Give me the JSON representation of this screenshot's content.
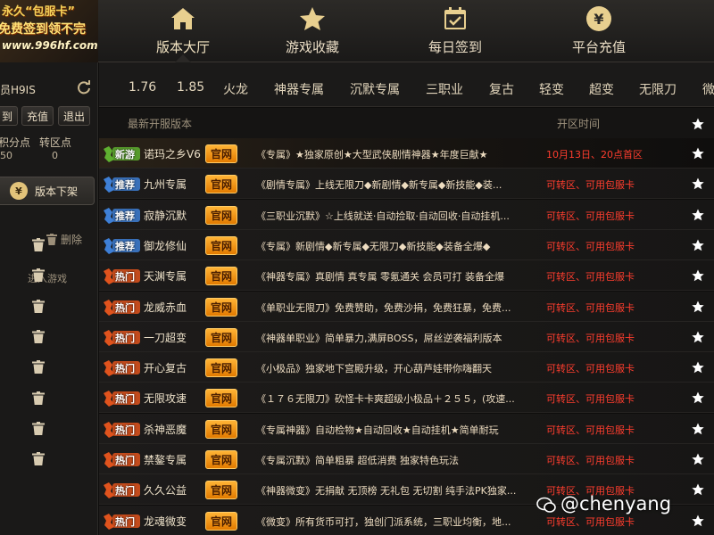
{
  "logo": {
    "line1": "永久“包服卡”",
    "line2": "免费签到领不完",
    "line3": "www.996hf.com"
  },
  "nav": [
    {
      "label": "版本大厅",
      "icon": "home-icon"
    },
    {
      "label": "游戏收藏",
      "icon": "star-icon"
    },
    {
      "label": "每日签到",
      "icon": "calendar-check-icon"
    },
    {
      "label": "平台充值",
      "icon": "yen-coin-icon"
    }
  ],
  "sidebar": {
    "username": "员H9IS",
    "btn_a": "到",
    "btn_b": "充值",
    "btn_c": "退出",
    "points_label": "积分点",
    "transfer_label": "转区点",
    "points_value": "50",
    "transfer_value": "0",
    "down_label": "版本下架",
    "delete_label": "删除",
    "enter_game": "进入游戏"
  },
  "filters": [
    "1.76",
    "1.85",
    "火龙",
    "神器专属",
    "沉默专属",
    "三职业",
    "复古",
    "轻变",
    "超变",
    "无限刀",
    "微"
  ],
  "table": {
    "col_latest": "最新开服版本",
    "col_time": "开区时间",
    "official_label": "官网",
    "rows": [
      {
        "tag": "新游",
        "tag_type": "new",
        "name": "诺玛之乡V6",
        "desc": "《专属》★独家原创★大型武侠剧情神器★年度巨献★",
        "time": "10月13日、20点首区"
      },
      {
        "tag": "推荐",
        "tag_type": "rec",
        "name": "九州专属",
        "desc": "《剧情专属》上线无限刀◆新剧情◆新专属◆新技能◆装...",
        "time": "可转区、可用包服卡"
      },
      {
        "tag": "推荐",
        "tag_type": "rec",
        "name": "寂静沉默",
        "desc": "《三职业沉默》☆上线就送·自动捡取·自动回收·自动挂机...",
        "time": "可转区、可用包服卡"
      },
      {
        "tag": "推荐",
        "tag_type": "rec",
        "name": "御龙修仙",
        "desc": "《专属》新剧情◆新专属◆无限刀◆新技能◆装备全爆◆",
        "time": "可转区、可用包服卡"
      },
      {
        "tag": "热门",
        "tag_type": "hot",
        "name": "天渊专属",
        "desc": "《神器专属》真剧情 真专属 零氪通关 会员可打 装备全爆",
        "time": "可转区、可用包服卡"
      },
      {
        "tag": "热门",
        "tag_type": "hot",
        "name": "龙威赤血",
        "desc": "《单职业无限刀》免费赞助，免费沙捐，免费狂暴，免费...",
        "time": "可转区、可用包服卡"
      },
      {
        "tag": "热门",
        "tag_type": "hot",
        "name": "一刀超变",
        "desc": "《神器单职业》简单暴力,满屏BOSS，屌丝逆袭福利版本",
        "time": "可转区、可用包服卡"
      },
      {
        "tag": "热门",
        "tag_type": "hot",
        "name": "开心复古",
        "desc": "《小极品》独家地下宫殿升级，开心葫芦娃带你嗨翻天",
        "time": "可转区、可用包服卡"
      },
      {
        "tag": "热门",
        "tag_type": "hot",
        "name": "无限攻速",
        "desc": "《１７６无限刀》砍怪卡卡爽超级小极品＋２５５，(攻速...",
        "time": "可转区、可用包服卡"
      },
      {
        "tag": "热门",
        "tag_type": "hot",
        "name": "杀神恶魔",
        "desc": "《专属神器》自动检物★自动回收★自动挂机★简单耐玩",
        "time": "可转区、可用包服卡"
      },
      {
        "tag": "热门",
        "tag_type": "hot",
        "name": "禁鏊专属",
        "desc": "《专属沉默》简单粗暴 超低消费 独家特色玩法",
        "time": "可转区、可用包服卡"
      },
      {
        "tag": "热门",
        "tag_type": "hot",
        "name": "久久公益",
        "desc": "《神器微变》无捐献 无顶榜 无礼包 无切割 纯手法PK独家...",
        "time": "可转区、可用包服卡"
      },
      {
        "tag": "热门",
        "tag_type": "hot",
        "name": "龙魂微变",
        "desc": "《微变》所有货币可打，独创门派系统，三职业均衡，地...",
        "time": "可转区、可用包服卡"
      }
    ]
  },
  "watermark": "@chenyang",
  "colors": {
    "accent_orange": "#ffb335",
    "time_red": "#ff3d2e",
    "new_tag": "#5fb030",
    "rec_tag": "#3e7fd6",
    "hot_tag": "#e0531d"
  }
}
